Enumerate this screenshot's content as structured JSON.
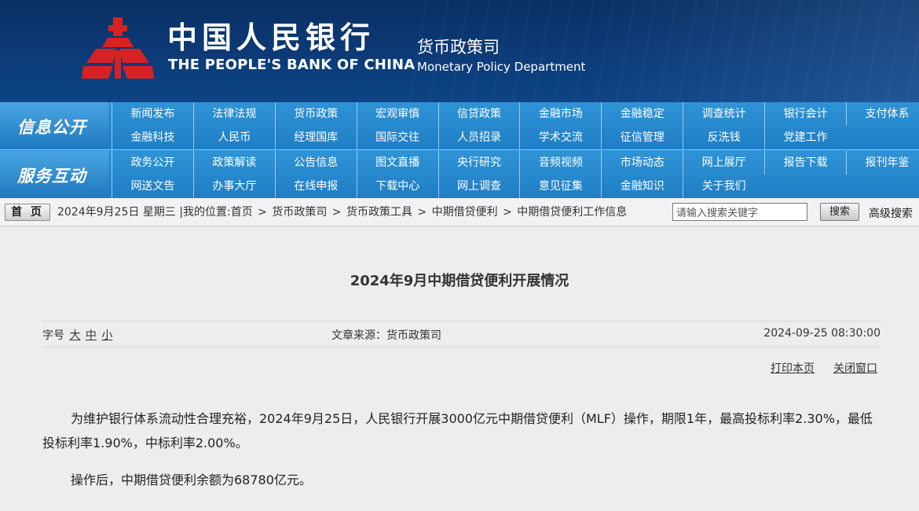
{
  "header": {
    "bank_name_cn": "中国人民银行",
    "bank_name_en": "THE PEOPLE'S BANK OF CHINA",
    "department_cn": "货币政策司",
    "department_en": "Monetary Policy Department",
    "logo_icon": "pboc-logo-icon",
    "colors": {
      "banner": "#0c3b78",
      "logo_red": "#d21f1f",
      "nav": "#2184c9"
    }
  },
  "nav": {
    "info_group": {
      "label": "信息公开",
      "items": [
        "新闻发布",
        "法律法规",
        "货币政策",
        "宏观审慎",
        "信贷政策",
        "金融市场",
        "金融稳定",
        "调查统计",
        "银行会计",
        "支付体系",
        "金融科技",
        "人民币",
        "经理国库",
        "国际交往",
        "人员招录",
        "学术交流",
        "征信管理",
        "反洗钱",
        "党建工作"
      ]
    },
    "service_group": {
      "label": "服务互动",
      "items": [
        "政务公开",
        "政策解读",
        "公告信息",
        "图文直播",
        "央行研究",
        "音频视频",
        "市场动态",
        "网上展厅",
        "报告下载",
        "报刊年鉴",
        "网送文告",
        "办事大厅",
        "在线申报",
        "下载中心",
        "网上调查",
        "意见征集",
        "金融知识",
        "关于我们"
      ]
    }
  },
  "breadcrumb": {
    "home_label": "首 页",
    "date": "2024年9月25日",
    "weekday": "星期三",
    "divider": "|",
    "location_label": "我的位置:",
    "path": [
      "首页",
      "货币政策司",
      "货币政策工具",
      "中期借贷便利",
      "中期借贷便利工作信息"
    ],
    "separator": ">"
  },
  "search": {
    "placeholder": "请输入搜索关键字",
    "button_label": "搜索",
    "advanced_label": "高级搜索"
  },
  "article": {
    "title": "2024年9月中期借贷便利开展情况",
    "font_size_label": "字号",
    "font_sizes": [
      "大",
      "中",
      "小"
    ],
    "source": "文章来源：货币政策司",
    "datetime": "2024-09-25 08:30:00",
    "print_label": "打印本页",
    "close_label": "关闭窗口",
    "paragraphs": [
      "为维护银行体系流动性合理充裕，2024年9月25日，人民银行开展3000亿元中期借贷便利（MLF）操作，期限1年，最高投标利率2.30%，最低投标利率1.90%，中标利率2.00%。",
      "操作后，中期借贷便利余额为68780亿元。"
    ]
  }
}
